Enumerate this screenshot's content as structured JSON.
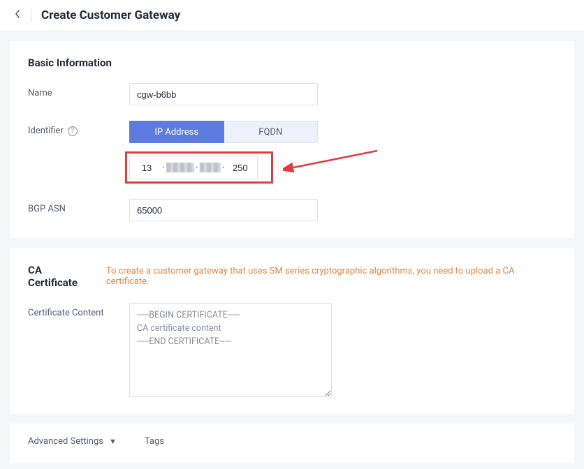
{
  "header": {
    "title": "Create Customer Gateway"
  },
  "basic": {
    "section_title": "Basic Information",
    "name_label": "Name",
    "name_value": "cgw-b6bb",
    "identifier_label": "Identifier",
    "identifier_options": {
      "ip": "IP Address",
      "fqdn": "FQDN"
    },
    "ip": {
      "oct1": "13",
      "oct4": "250"
    },
    "bgp_label": "BGP ASN",
    "bgp_value": "65000"
  },
  "cert": {
    "section_title": "CA Certificate",
    "note": "To create a customer gateway that uses SM series cryptographic algorithms, you need to upload a CA certificate.",
    "content_label": "Certificate Content",
    "placeholder": "-----BEGIN CERTIFICATE-----\nCA certificate content\n-----END CERTIFICATE-----"
  },
  "advanced": {
    "label": "Advanced Settings",
    "tags_label": "Tags"
  }
}
